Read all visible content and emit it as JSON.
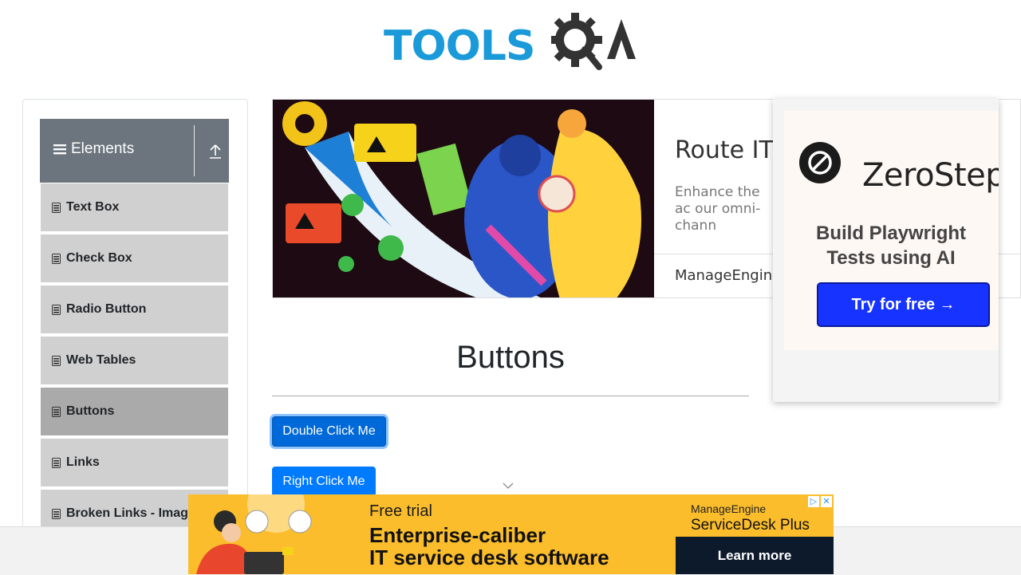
{
  "header": {
    "logo_text": "TOOLS",
    "logo_text_2": "QA"
  },
  "sidebar": {
    "group_title": "Elements",
    "items": [
      {
        "label": "Text Box"
      },
      {
        "label": "Check Box"
      },
      {
        "label": "Radio Button"
      },
      {
        "label": "Web Tables"
      },
      {
        "label": "Buttons",
        "active": true
      },
      {
        "label": "Links"
      },
      {
        "label": "Broken Links - Imag"
      }
    ]
  },
  "top_ad": {
    "headline": "Route IT t",
    "sub": "Enhance the ac our omni-chann",
    "brand": "ManageEngine"
  },
  "overlay_ad": {
    "name": "ZeroStep",
    "tagline": "Build Playwright Tests using AI",
    "cta": "Try for free →"
  },
  "main": {
    "title": "Buttons",
    "double_click": "Double Click Me",
    "right_click": "Right Click Me"
  },
  "bottom_ad": {
    "trial": "Free trial",
    "line1": "Enterprise-caliber",
    "line2": "IT service desk software",
    "vendor": "ManageEngine",
    "product": "ServiceDesk Plus",
    "cta": "Learn more"
  },
  "colors": {
    "primary": "#007bff",
    "sidebar_header": "#6c757d",
    "menu_bg": "#d0d0d0",
    "menu_active": "#aaaaaa",
    "logo_blue": "#1a9ad9"
  }
}
